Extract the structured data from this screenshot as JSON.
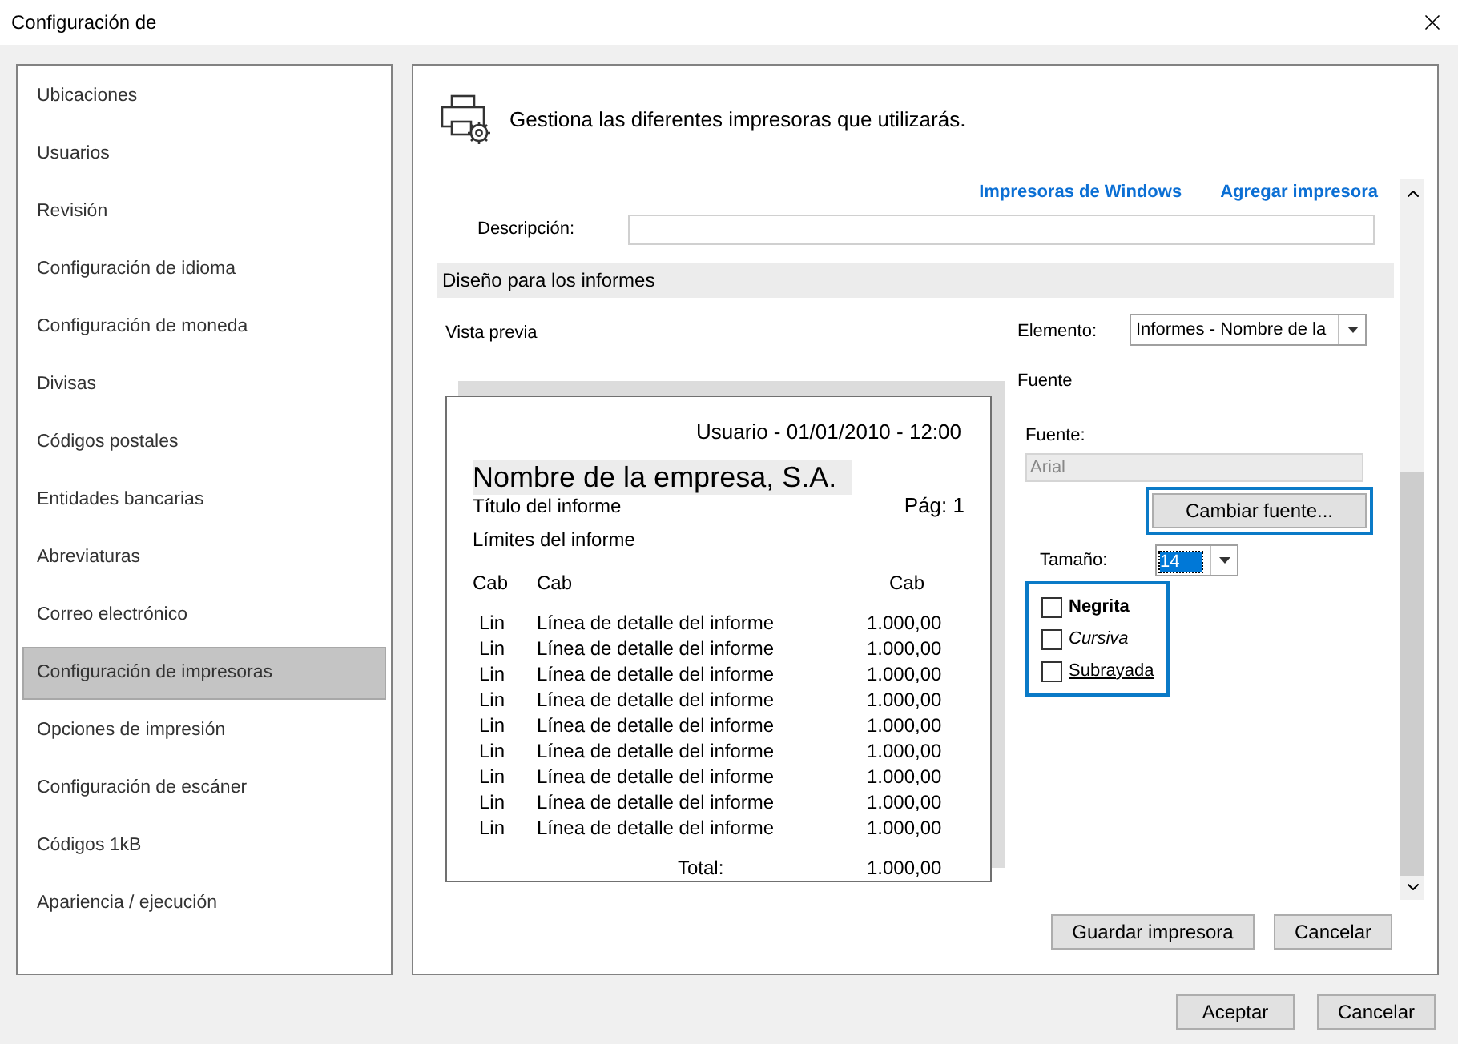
{
  "window": {
    "title": "Configuración de"
  },
  "sidebar": {
    "items": [
      {
        "label": "Ubicaciones",
        "selected": false
      },
      {
        "label": "Usuarios",
        "selected": false
      },
      {
        "label": "Revisión",
        "selected": false
      },
      {
        "label": "Configuración de idioma",
        "selected": false
      },
      {
        "label": "Configuración de moneda",
        "selected": false
      },
      {
        "label": "Divisas",
        "selected": false
      },
      {
        "label": "Códigos postales",
        "selected": false
      },
      {
        "label": "Entidades bancarias",
        "selected": false
      },
      {
        "label": "Abreviaturas",
        "selected": false
      },
      {
        "label": "Correo electrónico",
        "selected": false
      },
      {
        "label": "Configuración de impresoras",
        "selected": true
      },
      {
        "label": "Opciones de impresión",
        "selected": false
      },
      {
        "label": "Configuración de escáner",
        "selected": false
      },
      {
        "label": "Códigos 1kB",
        "selected": false
      },
      {
        "label": "Apariencia / ejecución",
        "selected": false
      }
    ]
  },
  "header": {
    "text": "Gestiona las diferentes impresoras que utilizarás."
  },
  "links": [
    "Impresoras de Windows",
    "Agregar impresora"
  ],
  "description": {
    "label": "Descripción:"
  },
  "section": {
    "title": "Diseño para los informes"
  },
  "preview": {
    "label": "Vista previa",
    "user_line": "Usuario - 01/01/2010 - 12:00",
    "company": "Nombre de la empresa, S.A.",
    "report_title": "Título del informe",
    "page": "Pág: 1",
    "limits": "Límites del informe",
    "headers": [
      "Cab",
      "Cab",
      "Cab"
    ],
    "rows": [
      [
        "Lin",
        "Línea de detalle del informe",
        "1.000,00"
      ],
      [
        "Lin",
        "Línea de detalle del informe",
        "1.000,00"
      ],
      [
        "Lin",
        "Línea de detalle del informe",
        "1.000,00"
      ],
      [
        "Lin",
        "Línea de detalle del informe",
        "1.000,00"
      ],
      [
        "Lin",
        "Línea de detalle del informe",
        "1.000,00"
      ],
      [
        "Lin",
        "Línea de detalle del informe",
        "1.000,00"
      ],
      [
        "Lin",
        "Línea de detalle del informe",
        "1.000,00"
      ],
      [
        "Lin",
        "Línea de detalle del informe",
        "1.000,00"
      ],
      [
        "Lin",
        "Línea de detalle del informe",
        "1.000,00"
      ]
    ],
    "total_label": "Total:",
    "total_value": "1.000,00"
  },
  "element": {
    "label": "Elemento:",
    "value": "Informes - Nombre de la"
  },
  "font_group": {
    "title": "Fuente",
    "label": "Fuente:",
    "value": "Arial",
    "disabled": true
  },
  "change_font": {
    "label": "Cambiar fuente...",
    "focused": true
  },
  "size": {
    "label": "Tamaño:",
    "value": "14",
    "focused": true
  },
  "styles": {
    "focused": true,
    "items": [
      {
        "label": "Negrita",
        "kind": "bold",
        "checked": false
      },
      {
        "label": "Cursiva",
        "kind": "italic",
        "checked": false
      },
      {
        "label": "Subrayada",
        "kind": "underline",
        "checked": false
      }
    ]
  },
  "panel_buttons": [
    "Guardar impresora",
    "Cancelar"
  ],
  "dialog_buttons": [
    "Aceptar",
    "Cancelar"
  ]
}
